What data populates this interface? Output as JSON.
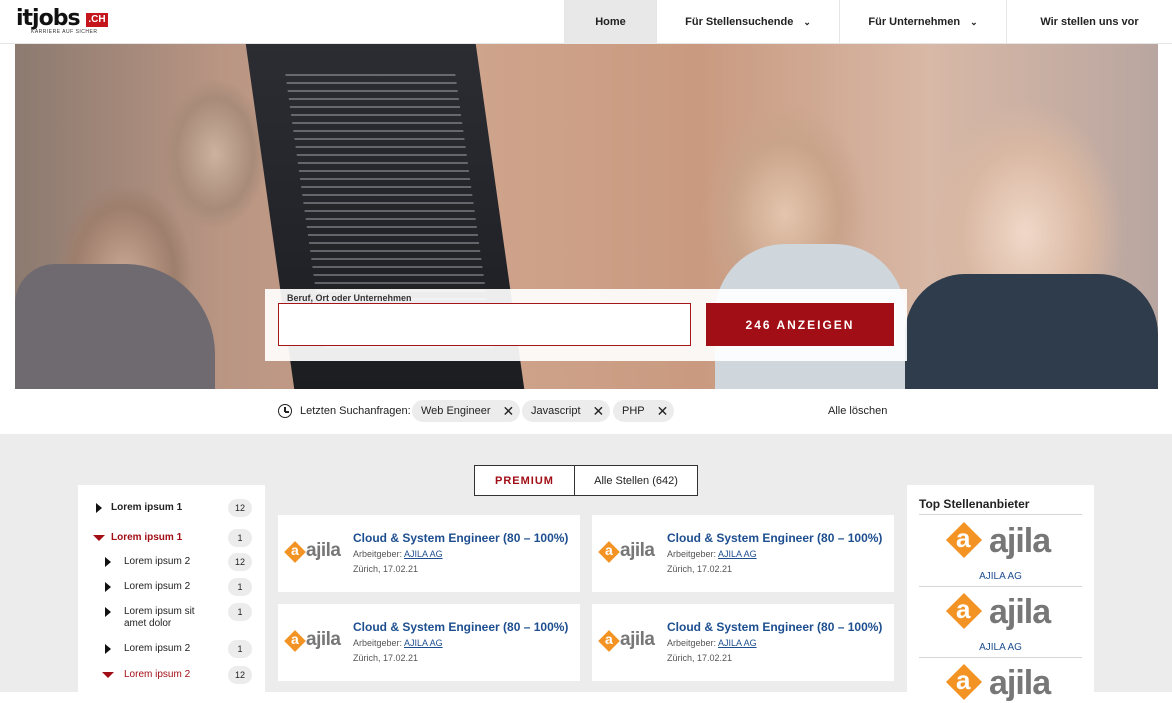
{
  "header": {
    "logo_text": "itjobs",
    "logo_suffix": ".CH",
    "logo_tagline": "KARRIERE AUF SICHER",
    "nav": [
      {
        "label": "Home",
        "active": true
      },
      {
        "label": "Für Stellensuchende",
        "has_dropdown": true
      },
      {
        "label": "Für Unternehmen",
        "has_dropdown": true
      },
      {
        "label": "Wir stellen uns vor"
      }
    ]
  },
  "search": {
    "label": "Beruf, Ort oder Unternehmen",
    "value": "",
    "button_label": "246 ANZEIGEN"
  },
  "recent": {
    "label": "Letzten Suchanfragen:",
    "chips": [
      "Web Engineer",
      "Javascript",
      "PHP"
    ],
    "clear_label": "Alle löschen"
  },
  "tabs": {
    "premium": "PREMIUM",
    "all": "Alle Stellen (642)"
  },
  "sidebar": {
    "items": [
      {
        "label": "Lorem ipsum 1",
        "count": "12",
        "state": "collapsed",
        "level": 0
      },
      {
        "label": "Lorem ipsum 1",
        "count": "1",
        "state": "expanded",
        "level": 0
      },
      {
        "label": "Lorem ipsum 2",
        "count": "12",
        "state": "collapsed",
        "level": 1
      },
      {
        "label": "Lorem ipsum 2",
        "count": "1",
        "state": "collapsed",
        "level": 1
      },
      {
        "label": "Lorem ipsum sit amet dolor",
        "count": "1",
        "state": "collapsed",
        "level": 1
      },
      {
        "label": "Lorem ipsum 2",
        "count": "1",
        "state": "collapsed",
        "level": 1
      },
      {
        "label": "Lorem ipsum 2",
        "count": "12",
        "state": "expanded",
        "level": 1
      }
    ]
  },
  "jobs": [
    {
      "title": "Cloud & System Engineer (80 – 100%)",
      "employer_label": "Arbeitgeber:",
      "employer": "AJILA AG",
      "location": "Zürich",
      "date": "17.02.21",
      "logo": "ajila"
    },
    {
      "title": "Cloud & System Engineer (80 – 100%)",
      "employer_label": "Arbeitgeber:",
      "employer": "AJILA AG",
      "location": "Zürich",
      "date": "17.02.21",
      "logo": "ajila"
    },
    {
      "title": "Cloud & System Engineer (80 – 100%)",
      "employer_label": "Arbeitgeber:",
      "employer": "AJILA AG",
      "location": "Zürich",
      "date": "17.02.21",
      "logo": "ajila"
    },
    {
      "title": "Cloud & System Engineer (80 – 100%)",
      "employer_label": "Arbeitgeber:",
      "employer": "AJILA AG",
      "location": "Zürich",
      "date": "17.02.21",
      "logo": "ajila"
    }
  ],
  "top_panel": {
    "title": "Top Stellenanbieter",
    "providers": [
      {
        "logo": "ajila",
        "name": "AJILA AG"
      },
      {
        "logo": "ajila",
        "name": "AJILA AG"
      },
      {
        "logo": "ajila",
        "name": ""
      }
    ]
  },
  "colors": {
    "brand_red": "#a10e15",
    "link_blue": "#1d4e8f",
    "ajila_orange": "#f39323",
    "page_gray": "#ececec"
  }
}
